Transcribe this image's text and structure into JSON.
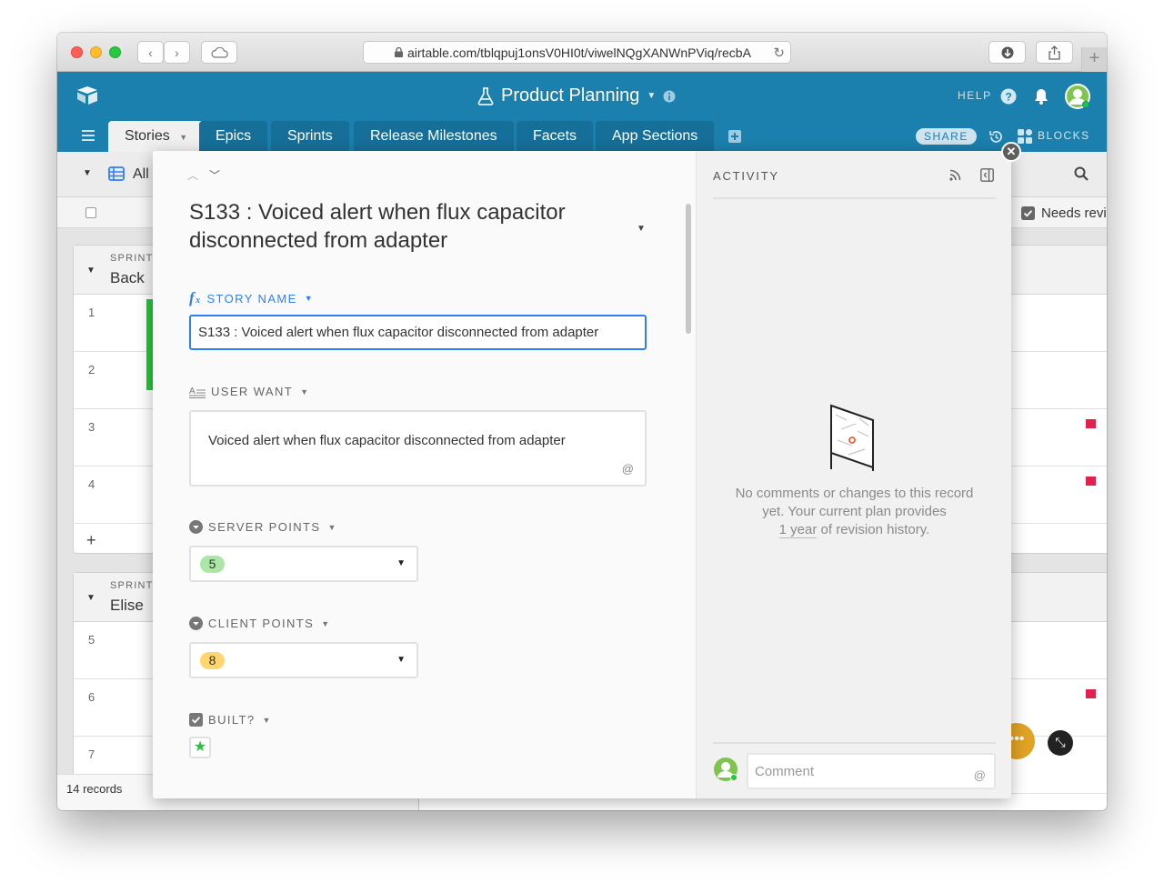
{
  "browser": {
    "url": "airtable.com/tblqpuj1onsV0HI0t/viwelNQgXANWnPViq/recbA"
  },
  "header": {
    "base_name": "Product Planning",
    "help_label": "HELP",
    "share_label": "SHARE",
    "blocks_label": "BLOCKS",
    "accent_color": "#1b80ad"
  },
  "tabs": [
    {
      "label": "Stories"
    },
    {
      "label": "Epics"
    },
    {
      "label": "Sprints"
    },
    {
      "label": "Release Milestones"
    },
    {
      "label": "Facets"
    },
    {
      "label": "App Sections"
    }
  ],
  "background_grid": {
    "view_name": "All",
    "needs_review_label": "Needs revi",
    "groups": [
      {
        "label": "SPRINT",
        "name": "Back",
        "rows": [
          "1",
          "2",
          "3",
          "4"
        ]
      },
      {
        "label": "SPRINT",
        "name": "Elise",
        "rows": [
          "5",
          "6",
          "7"
        ]
      }
    ],
    "add_row": "+",
    "records_count": "14 records"
  },
  "record": {
    "title": "S133 : Voiced alert when flux capacitor disconnected from adapter",
    "fields": {
      "story_name": {
        "label": "STORY NAME",
        "value": "S133 : Voiced alert when flux capacitor disconnected from adapter"
      },
      "user_want": {
        "label": "USER WANT",
        "value": "Voiced alert when flux capacitor disconnected from adapter",
        "mention": "@"
      },
      "server_points": {
        "label": "SERVER POINTS",
        "value": "5",
        "color": "#aae6a5"
      },
      "client_points": {
        "label": "CLIENT POINTS",
        "value": "8",
        "color": "#ffd66e"
      },
      "built": {
        "label": "BUILT?",
        "checked": true
      }
    }
  },
  "activity": {
    "title": "ACTIVITY",
    "empty_line1": "No comments or changes to this record",
    "empty_line2": "yet. Your current plan provides",
    "empty_link": "1 year",
    "empty_line3_rest": " of revision history.",
    "comment_placeholder": "Comment",
    "comment_mention": "@"
  }
}
